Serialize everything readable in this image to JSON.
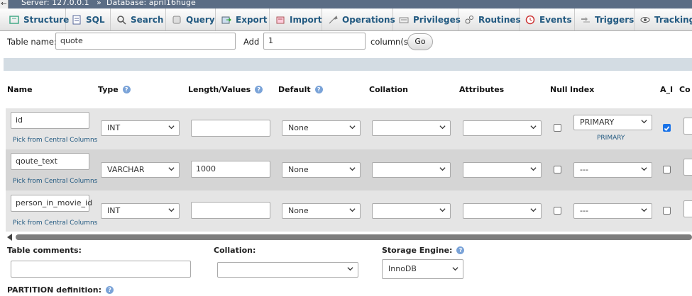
{
  "breadcrumb": {
    "server": "Server: 127.0.0.1",
    "sep": "»",
    "database": "Database: april16huge"
  },
  "tabs": [
    {
      "label": "Structure",
      "icon": "structure-icon"
    },
    {
      "label": "SQL",
      "icon": "sql-icon"
    },
    {
      "label": "Search",
      "icon": "search-icon"
    },
    {
      "label": "Query",
      "icon": "query-icon"
    },
    {
      "label": "Export",
      "icon": "export-icon"
    },
    {
      "label": "Import",
      "icon": "import-icon"
    },
    {
      "label": "Operations",
      "icon": "operations-icon"
    },
    {
      "label": "Privileges",
      "icon": "privileges-icon"
    },
    {
      "label": "Routines",
      "icon": "routines-icon"
    },
    {
      "label": "Events",
      "icon": "events-icon"
    },
    {
      "label": "Triggers",
      "icon": "triggers-icon"
    },
    {
      "label": "Tracking",
      "icon": "tracking-icon"
    }
  ],
  "table_form": {
    "table_name_label": "Table name:",
    "table_name_value": "quote",
    "add_label": "Add",
    "add_value": "1",
    "columns_label": "column(s)",
    "go_label": "Go"
  },
  "headers": {
    "name": "Name",
    "type": "Type",
    "length": "Length/Values",
    "default": "Default",
    "collation": "Collation",
    "attributes": "Attributes",
    "null": "Null",
    "index": "Index",
    "ai": "A_I",
    "comments": "Co"
  },
  "fields": [
    {
      "name": "id",
      "pick_link": "Pick from Central Columns",
      "type": "INT",
      "length": "",
      "default": "None",
      "collation": "",
      "attributes": "",
      "null": false,
      "index": "PRIMARY",
      "index_note": "PRIMARY",
      "ai": true
    },
    {
      "name": "qoute_text",
      "pick_link": "Pick from Central Columns",
      "type": "VARCHAR",
      "length": "1000",
      "default": "None",
      "collation": "",
      "attributes": "",
      "null": false,
      "index": "---",
      "index_note": "",
      "ai": false
    },
    {
      "name": "person_in_movie_id",
      "pick_link": "Pick from Central Columns",
      "type": "INT",
      "length": "",
      "default": "None",
      "collation": "",
      "attributes": "",
      "null": false,
      "index": "---",
      "index_note": "",
      "ai": false
    }
  ],
  "bottom": {
    "table_comments_label": "Table comments:",
    "table_comments_value": "",
    "collation_label": "Collation:",
    "collation_value": "",
    "engine_label": "Storage Engine:",
    "engine_value": "InnoDB",
    "partition_label": "PARTITION definition:"
  },
  "colors": {
    "accent": "#235a81",
    "checkbox_on": "#1a73e8"
  }
}
